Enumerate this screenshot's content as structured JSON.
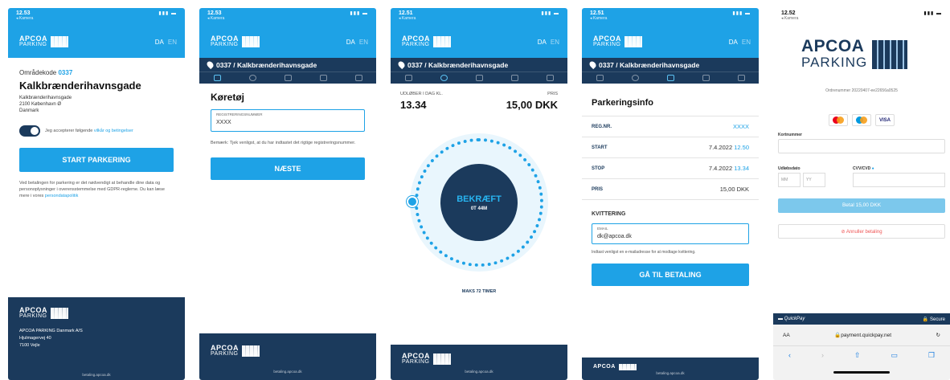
{
  "colors": {
    "brand_blue": "#1ea2e6",
    "navy": "#1b3a5c",
    "accent_orange": "#ff8a00"
  },
  "screens": [
    {
      "status_time": "12.53",
      "status_back": "◂ Kamera",
      "logo_text": "APCOA",
      "logo_sub": "PARKING",
      "lang_da": "DA",
      "lang_en": "EN",
      "area_label": "Områdekode",
      "area_code": "0337",
      "street": "Kalkbrænderihavnsgade",
      "address_line1": "Kalkbrænderihavnsgade",
      "address_line2": "2100 København Ø",
      "address_line3": "Danmark",
      "toggle_text": "Jeg accepterer følgende",
      "toggle_link": "vilkår og betingelser",
      "start_button": "START PARKERING",
      "notice": "Ved betalingen for parkering er det nødvendigt at behandle dine data og personoplysninger i overensstemmelse med GDPR-reglerne. Du kan læse mere i vores",
      "notice_link": "persondatapolitik",
      "footer_company": "APCOA PARKING Danmark A/S",
      "footer_street": "Hjulmagervej 40",
      "footer_city": "7100 Vejle",
      "footer_url": "betaling.apcoa.dk"
    },
    {
      "status_time": "12.53",
      "status_back": "◂ Kamera",
      "location_bar": "0337 / Kalkbrænderihavnsgade",
      "heading": "Køretøj",
      "field_label": "REGISTRERINGSNUMMER",
      "field_value": "XXXX",
      "remark": "Bemærk: Tjek venligst, at du har indtastet det rigtige registreringsnummer.",
      "next_button": "NÆSTE",
      "footer_url": "betaling.apcoa.dk"
    },
    {
      "status_time": "12.51",
      "status_back": "◂ Kamera",
      "location_bar": "0337 / Kalkbrænderihavnsgade",
      "duration_label": "UDLØBER I DAG KL.",
      "duration_value": "13.34",
      "price_label": "PRIS",
      "price_value": "15,00 DKK",
      "confirm": "BEKRÆFT",
      "confirm_sub": "0T 44M",
      "max_label": "MAKS 72 TIMER",
      "footer_url": "betaling.apcoa.dk"
    },
    {
      "status_time": "12.51",
      "status_back": "◂ Kamera",
      "location_bar": "0337 / Kalkbrænderihavnsgade",
      "heading": "Parkeringsinfo",
      "rows": [
        {
          "k": "REG.NR.",
          "v1": "",
          "v2": "XXXX"
        },
        {
          "k": "START",
          "v1": "7.4.2022",
          "v2": "12.50"
        },
        {
          "k": "STOP",
          "v1": "7.4.2022",
          "v2": "13.34"
        },
        {
          "k": "PRIS",
          "v1": "15,00 DKK",
          "v2": ""
        }
      ],
      "receipt_label": "KVITTERING",
      "email_label": "EMAIL",
      "email_value": "dk@apcoa.dk",
      "email_hint": "Indtast venligst en e-mailadresse for at modtage kvittering.",
      "pay_button": "GÅ TIL BETALING",
      "footer_url": "betaling.apcoa.dk"
    },
    {
      "status_time": "12.52",
      "status_back": "◂ Kamera",
      "logo_text": "APCOA",
      "logo_sub": "PARKING",
      "order_label": "Ordrenummer",
      "order_value": "20220407-ee22656a0525",
      "card_visa": "VISA",
      "card_number_label": "Kortnummer",
      "expiry_label": "Udløbsdato",
      "cvv_label": "CVV/CVD",
      "mm": "MM",
      "yy": "YY",
      "pay_button": "Betal 15,00 DKK",
      "cancel": "Annuller betaling",
      "quickpay": "QuickPay",
      "secure": "Secure",
      "url_aa": "AA",
      "url": "payment.quickpay.net"
    }
  ]
}
